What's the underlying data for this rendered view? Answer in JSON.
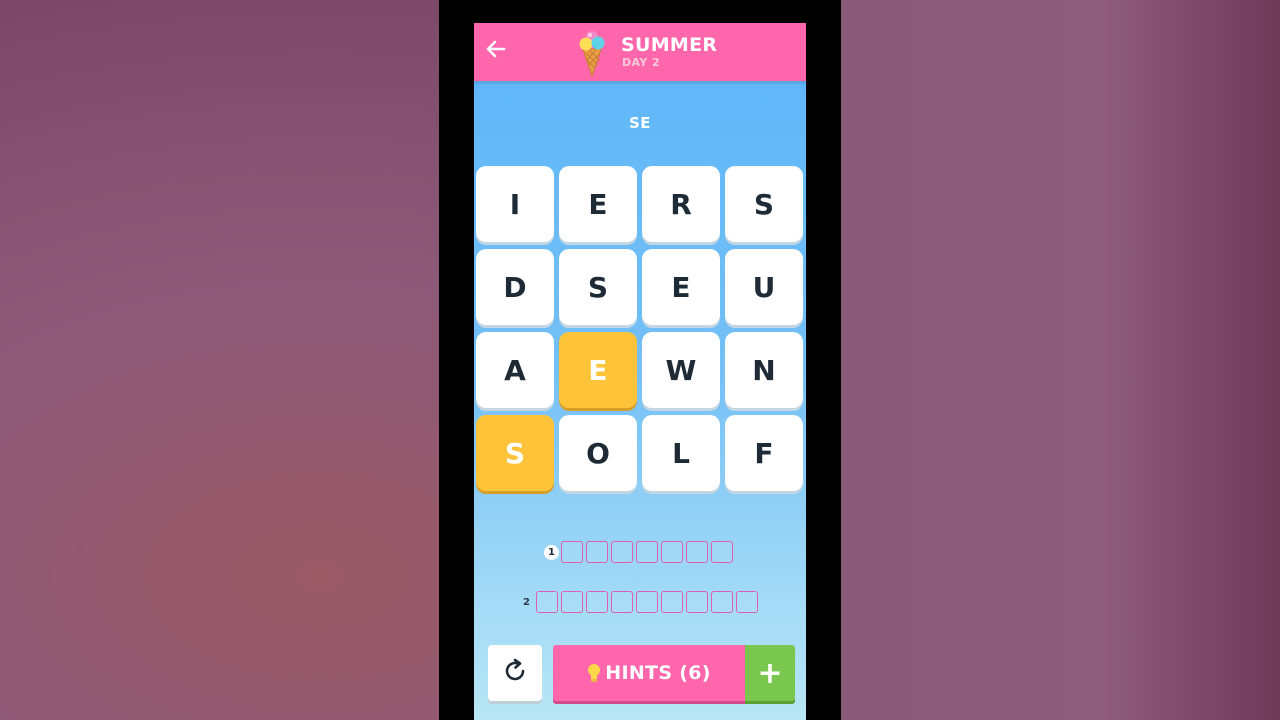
{
  "header": {
    "title": "SUMMER",
    "subtitle": "DAY 2",
    "back_icon": "arrow-left-icon",
    "level_icon": "ice-cream-cone-icon"
  },
  "current_word": "SE",
  "grid": {
    "rows": 4,
    "cols": 4,
    "tiles": [
      {
        "letter": "I",
        "selected": false
      },
      {
        "letter": "E",
        "selected": false
      },
      {
        "letter": "R",
        "selected": false
      },
      {
        "letter": "S",
        "selected": false
      },
      {
        "letter": "D",
        "selected": false
      },
      {
        "letter": "S",
        "selected": false
      },
      {
        "letter": "E",
        "selected": false
      },
      {
        "letter": "U",
        "selected": false
      },
      {
        "letter": "A",
        "selected": false
      },
      {
        "letter": "E",
        "selected": true
      },
      {
        "letter": "W",
        "selected": false
      },
      {
        "letter": "N",
        "selected": false
      },
      {
        "letter": "S",
        "selected": true
      },
      {
        "letter": "O",
        "selected": false
      },
      {
        "letter": "L",
        "selected": false
      },
      {
        "letter": "F",
        "selected": false
      }
    ]
  },
  "answers": [
    {
      "number": "1",
      "length": 7,
      "active": true
    },
    {
      "number": "2",
      "length": 9,
      "active": false
    }
  ],
  "controls": {
    "refresh_icon": "refresh-icon",
    "hints_label": "HINTS (6)",
    "hint_icon": "lightbulb-icon",
    "plus_label": "+"
  },
  "colors": {
    "header_pink": "#ff66ab",
    "selected_tile": "#ffc33a",
    "plus_green": "#7ac74f",
    "sky_blue": "#5cb5f8"
  }
}
